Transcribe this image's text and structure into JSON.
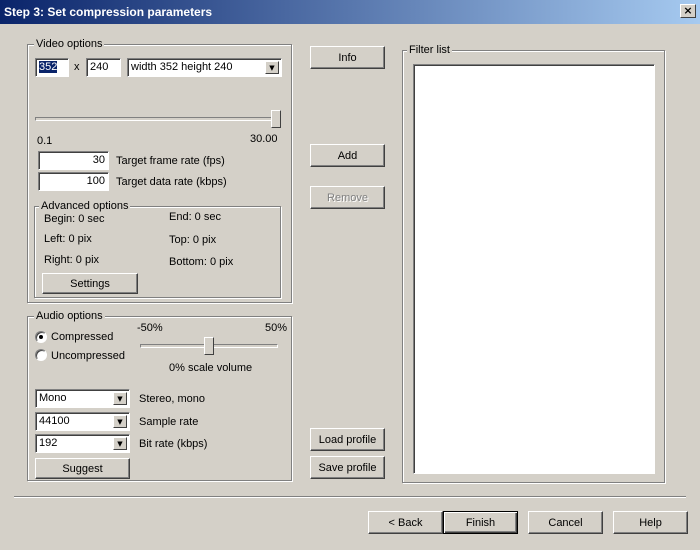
{
  "window": {
    "title": "Step 3: Set compression parameters",
    "close_glyph": "×"
  },
  "video": {
    "group_title": "Video options",
    "width": "352",
    "x_sep": "x",
    "height": "240",
    "size_preset": "width 352 height 240",
    "slider_min": "0.1",
    "slider_max": "30.00",
    "slider_level": 1.0,
    "frame_rate": "30",
    "frame_rate_label": "Target frame rate (fps)",
    "data_rate": "100",
    "data_rate_label": "Target data rate (kbps)"
  },
  "advanced": {
    "group_title": "Advanced options",
    "begin": "Begin: 0 sec",
    "end": "End: 0 sec",
    "left": "Left: 0 pix",
    "top": "Top: 0 pix",
    "right": "Right: 0 pix",
    "bottom": "Bottom: 0 pix",
    "settings_label": "Settings"
  },
  "audio": {
    "group_title": "Audio options",
    "compressed_label": "Compressed",
    "uncompressed_label": "Uncompressed",
    "selected_mode": "Compressed",
    "vol_min": "-50%",
    "vol_max": "50%",
    "volume_label": "0% scale volume",
    "volume_level": 0.5,
    "channels": "Mono",
    "channels_label": "Stereo, mono",
    "sample_rate": "44100",
    "sample_rate_label": "Sample rate",
    "bit_rate": "192",
    "bit_rate_label": "Bit rate (kbps)",
    "suggest_label": "Suggest"
  },
  "middle": {
    "info_label": "Info",
    "add_label": "Add",
    "remove_label": "Remove",
    "load_profile_label": "Load profile",
    "save_profile_label": "Save profile"
  },
  "filter": {
    "group_title": "Filter list"
  },
  "footer": {
    "back_label": "< Back",
    "finish_label": "Finish",
    "cancel_label": "Cancel",
    "help_label": "Help"
  },
  "icons": {
    "dropdown": "▼"
  }
}
